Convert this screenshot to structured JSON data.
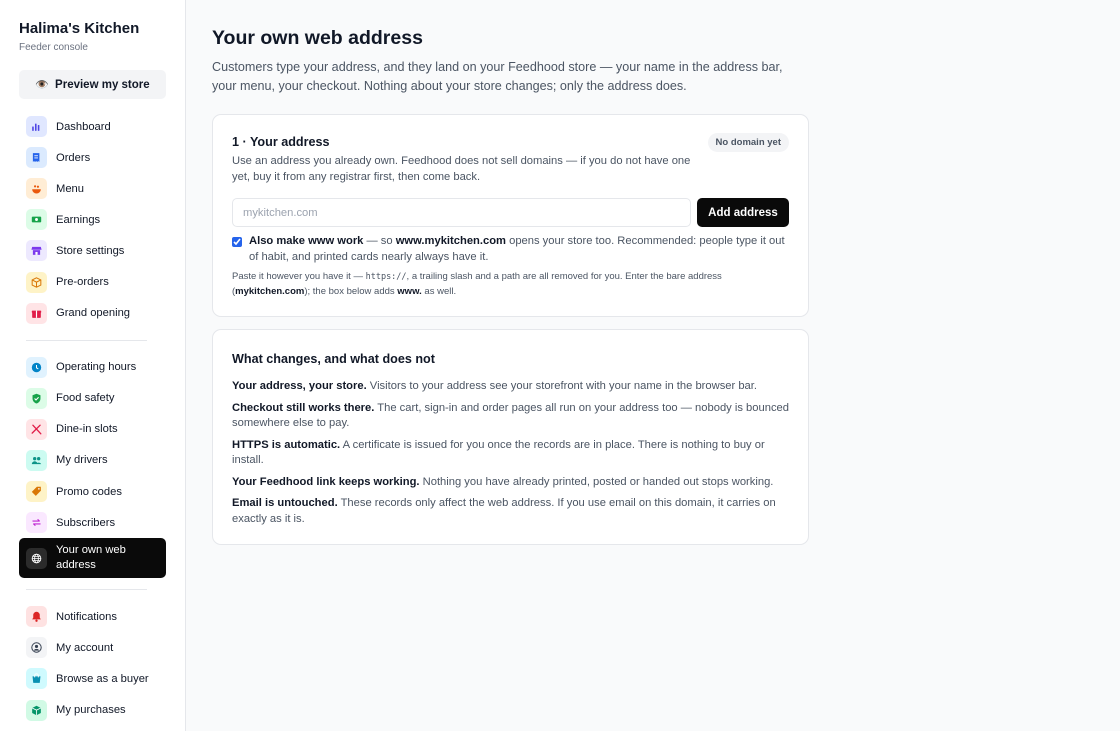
{
  "sidebar": {
    "brand": "Halima's Kitchen",
    "subtitle": "Feeder console",
    "preview_label": "Preview my store",
    "groups": [
      [
        {
          "label": "Dashboard",
          "icon": "bar-chart-icon",
          "bg": "#e0e7ff",
          "fg": "#4f46e5"
        },
        {
          "label": "Orders",
          "icon": "receipt-icon",
          "bg": "#dbeafe",
          "fg": "#2563eb"
        },
        {
          "label": "Menu",
          "icon": "food-icon",
          "bg": "#ffedd5",
          "fg": "#ea580c"
        },
        {
          "label": "Earnings",
          "icon": "banknote-icon",
          "bg": "#dcfce7",
          "fg": "#16a34a"
        },
        {
          "label": "Store settings",
          "icon": "store-icon",
          "bg": "#ede9fe",
          "fg": "#7c3aed"
        },
        {
          "label": "Pre-orders",
          "icon": "box-icon",
          "bg": "#fef3c7",
          "fg": "#d97706"
        },
        {
          "label": "Grand opening",
          "icon": "gift-icon",
          "bg": "#ffe4e6",
          "fg": "#e11d48"
        }
      ],
      [
        {
          "label": "Operating hours",
          "icon": "clock-icon",
          "bg": "#e0f2fe",
          "fg": "#0284c7"
        },
        {
          "label": "Food safety",
          "icon": "shield-check-icon",
          "bg": "#dcfce7",
          "fg": "#16a34a"
        },
        {
          "label": "Dine-in slots",
          "icon": "utensils-icon",
          "bg": "#ffe4e6",
          "fg": "#e11d48"
        },
        {
          "label": "My drivers",
          "icon": "people-icon",
          "bg": "#ccfbf1",
          "fg": "#0d9488"
        },
        {
          "label": "Promo codes",
          "icon": "tag-icon",
          "bg": "#fef3c7",
          "fg": "#d97706"
        },
        {
          "label": "Subscribers",
          "icon": "repeat-icon",
          "bg": "#fae8ff",
          "fg": "#c026d3"
        },
        {
          "label": "Your own web address",
          "icon": "globe-icon",
          "bg": "#2b2b2b",
          "fg": "#ffffff",
          "active": true
        }
      ],
      [
        {
          "label": "Notifications",
          "icon": "bell-icon",
          "bg": "#fee2e2",
          "fg": "#dc2626"
        },
        {
          "label": "My account",
          "icon": "user-circle-icon",
          "bg": "#f3f4f6",
          "fg": "#374151"
        },
        {
          "label": "Browse as a buyer",
          "icon": "shopping-bag-icon",
          "bg": "#cffafe",
          "fg": "#0891b2"
        },
        {
          "label": "My purchases",
          "icon": "package-icon",
          "bg": "#d1fae5",
          "fg": "#059669"
        }
      ]
    ]
  },
  "page": {
    "title": "Your own web address",
    "description": "Customers type your address, and they land on your Feedhood store — your name in the address bar, your menu, your checkout. Nothing about your store changes; only the address does."
  },
  "address_card": {
    "title": "1 · Your address",
    "badge": "No domain yet",
    "description": "Use an address you already own. Feedhood does not sell domains — if you do not have one yet, buy it from any registrar first, then come back.",
    "input_value": "",
    "input_placeholder": "mykitchen.com",
    "add_button": "Add address",
    "www_checked": true,
    "www_bold": "Also make www work",
    "www_mid": " — so ",
    "www_domain": "www.mykitchen.com",
    "www_rest": " opens your store too. Recommended: people type it out of habit, and printed cards nearly always have it.",
    "help_1": "Paste it however you have it — ",
    "help_code": "https://",
    "help_2": ", a trailing slash and a path are all removed for you. Enter the bare address (",
    "help_bold1": "mykitchen.com",
    "help_3": "); the box below adds ",
    "help_bold2": "www.",
    "help_4": " as well."
  },
  "changes_card": {
    "title": "What changes, and what does not",
    "facts": [
      {
        "bold": "Your address, your store.",
        "text": " Visitors to your address see your storefront with your name in the browser bar."
      },
      {
        "bold": "Checkout still works there.",
        "text": " The cart, sign-in and order pages all run on your address too — nobody is bounced somewhere else to pay."
      },
      {
        "bold": "HTTPS is automatic.",
        "text": " A certificate is issued for you once the records are in place. There is nothing to buy or install."
      },
      {
        "bold": "Your Feedhood link keeps working.",
        "text": " Nothing you have already printed, posted or handed out stops working."
      },
      {
        "bold": "Email is untouched.",
        "text": " These records only affect the web address. If you use email on this domain, it carries on exactly as it is."
      }
    ]
  }
}
